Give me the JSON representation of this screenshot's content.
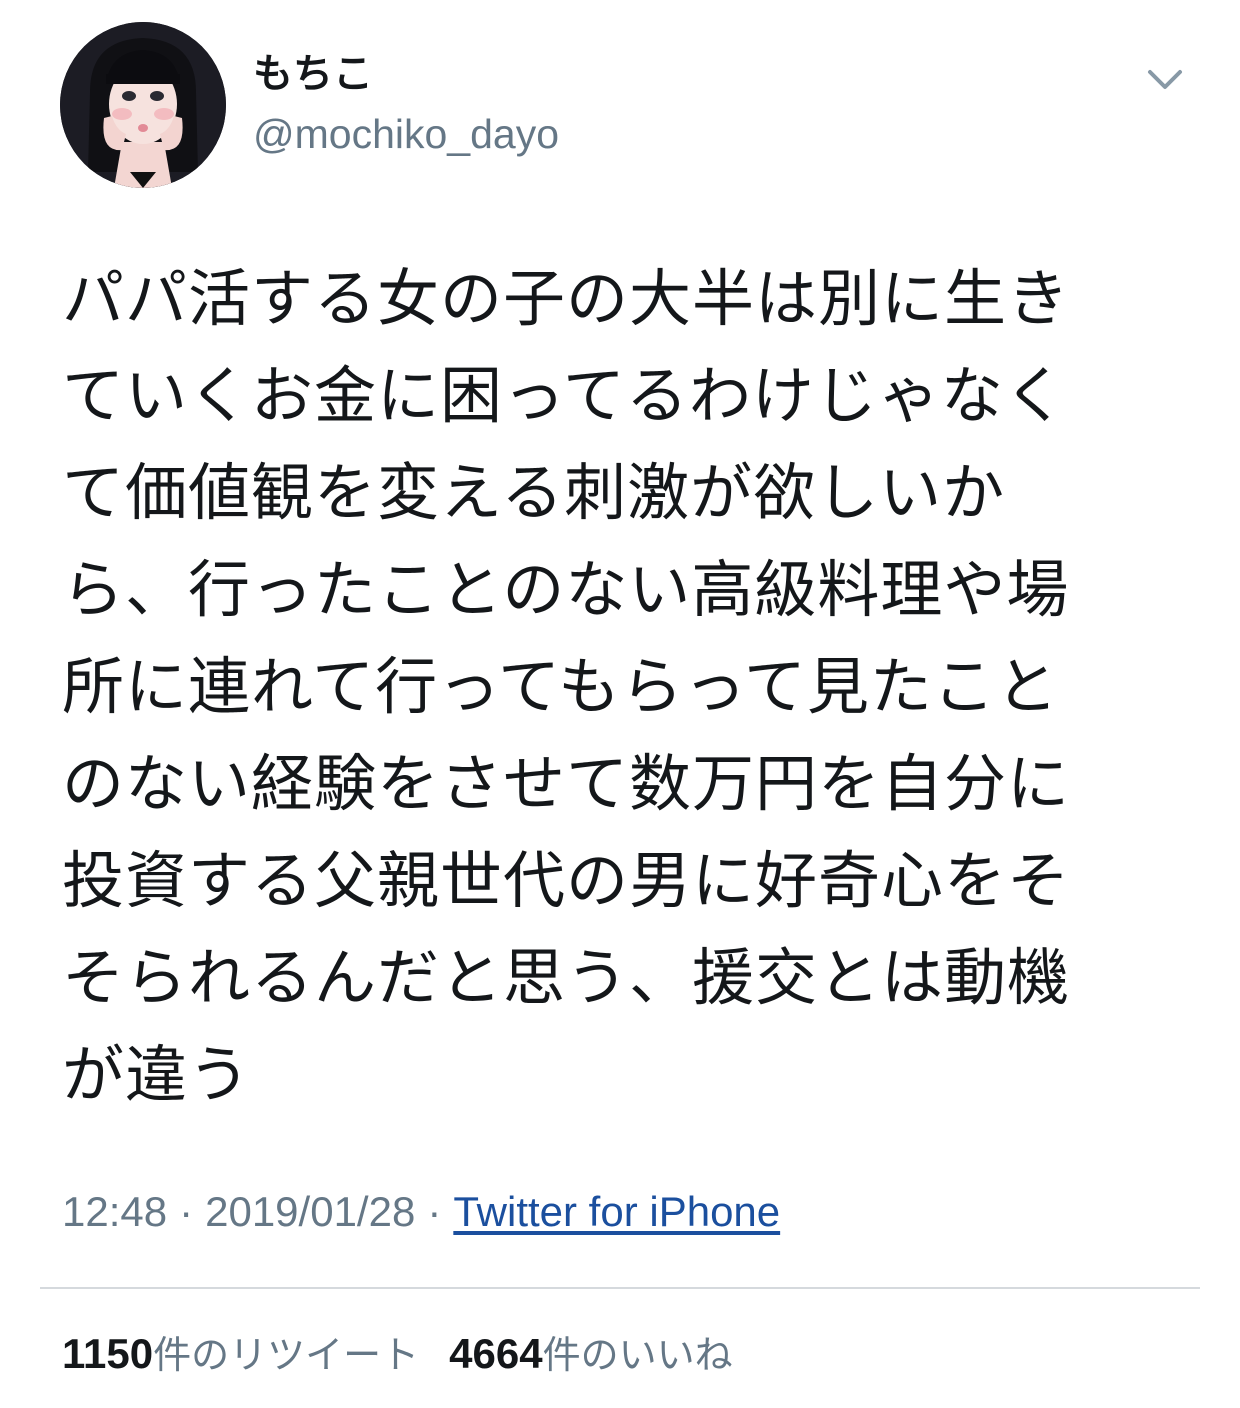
{
  "user": {
    "display_name": "もちこ",
    "handle": "@mochiko_dayo",
    "avatar_icon": "profile-avatar"
  },
  "menu": {
    "icon": "chevron-down-icon"
  },
  "tweet": {
    "lines": [
      "パパ活する女の子の大半は別に生き",
      "ていくお金に困ってるわけじゃなく",
      "て価値観を変える刺激が欲しいか",
      "ら、行ったことのない高級料理や場",
      "所に連れて行ってもらって見たこと",
      "のない経験をさせて数万円を自分に",
      "投資する父親世代の男に好奇心をそ",
      "そられるんだと思う、援交とは動機",
      "が違う"
    ]
  },
  "meta": {
    "time": "12:48",
    "separator": "·",
    "date": "2019/01/28",
    "source": "Twitter for iPhone"
  },
  "stats": {
    "retweets_count": "1150",
    "retweets_label": "件のリツイート",
    "likes_count": "4664",
    "likes_label": "件のいいね"
  },
  "colors": {
    "text": "#14171a",
    "secondary": "#657786",
    "link": "#1b4f9e",
    "divider": "#d5d9dd"
  }
}
